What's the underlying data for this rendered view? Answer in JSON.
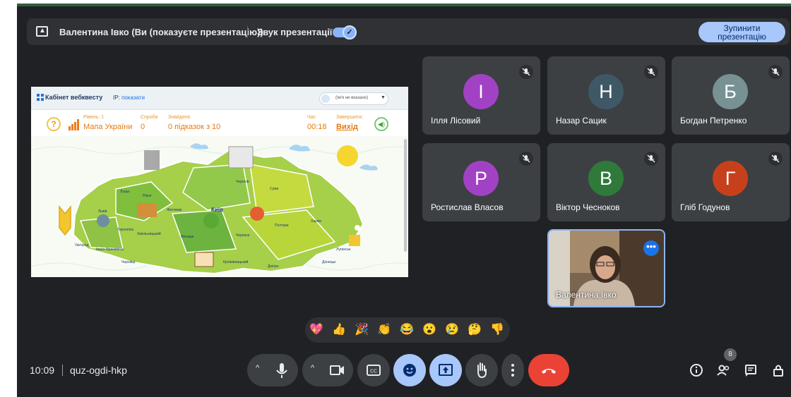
{
  "presentation_bar": {
    "presenter_label": "Валентина Івко (Ви (показуєте презентацію))",
    "sound_label": "Звук презентації",
    "sound_enabled": true,
    "stop_button_label": "Зупинити презентацію"
  },
  "shared_screen": {
    "site_title": "Кабінет вебквесту",
    "ip_label": "IP:",
    "ip_link": "показати",
    "name_select": "(Ім'я не вказано)",
    "level_caption": "Рівень: 1",
    "level_value": "Мапа України",
    "attempts_caption": "Спроби",
    "attempts_value": "0",
    "found_caption": "Знайдено",
    "found_value": "0 підказок з 10",
    "time_caption": "Час",
    "time_value": "00:18",
    "finish_caption": "Завершити:",
    "finish_value": "Вихід",
    "map_labels": [
      "Київ",
      "Луцьк",
      "Рівне",
      "Житомир",
      "Чернігів",
      "Суми",
      "Харків",
      "Полтава",
      "Черкаси",
      "Вінниця",
      "Хмельницький",
      "Тернопіль",
      "Львів",
      "Ужгород",
      "Івано-Франківськ",
      "Чернівці",
      "Кропивницький",
      "Дніпро",
      "Луганськ",
      "Донецьк"
    ]
  },
  "participants": [
    {
      "initial": "І",
      "name": "Ілля Лісовий",
      "color": "#a142c4",
      "muted": true
    },
    {
      "initial": "Н",
      "name": "Назар Сацик",
      "color": "#3f5866",
      "muted": true
    },
    {
      "initial": "Б",
      "name": "Богдан Петренко",
      "color": "#789193",
      "muted": true
    },
    {
      "initial": "Р",
      "name": "Ростислав Власов",
      "color": "#a142c4",
      "muted": true
    },
    {
      "initial": "В",
      "name": "Віктор Чесноков",
      "color": "#2f7a3a",
      "muted": true
    },
    {
      "initial": "Г",
      "name": "Гліб Годунов",
      "color": "#c6411b",
      "muted": true
    }
  ],
  "self_tile": {
    "name": "Валентина Івко",
    "more_icon": "more-horiz-icon"
  },
  "reactions": [
    "💖",
    "👍",
    "🎉",
    "👏",
    "😂",
    "😮",
    "😢",
    "🤔",
    "👎"
  ],
  "bottom_bar": {
    "time": "10:09",
    "separator": "|",
    "meeting_code": "quz-ogdi-hkp",
    "people_count": "8",
    "controls": [
      "chevron-up-icon",
      "mic-icon",
      "chevron-up-icon",
      "camera-icon",
      "captions-icon",
      "emoji-icon",
      "present-icon",
      "raise-hand-icon",
      "more-vert-icon",
      "end-call-icon"
    ],
    "right_icons": [
      "info-icon",
      "people-icon",
      "chat-icon",
      "lock-icon"
    ]
  },
  "colors": {
    "background": "#202124",
    "accent": "#8ab4f8",
    "end_call": "#ea4335",
    "active_control": "#a8c7fa"
  }
}
